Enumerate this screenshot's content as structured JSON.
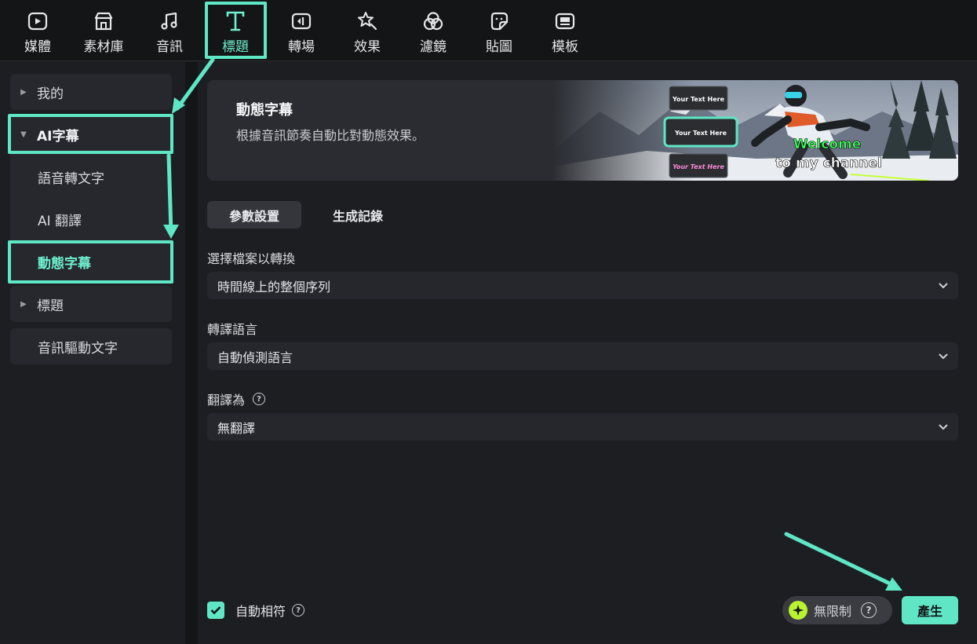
{
  "toolbar": {
    "items": [
      {
        "label": "媒體",
        "icon": "media-icon"
      },
      {
        "label": "素材庫",
        "icon": "library-icon"
      },
      {
        "label": "音訊",
        "icon": "music-icon"
      },
      {
        "label": "標題",
        "icon": "title-icon"
      },
      {
        "label": "轉場",
        "icon": "transition-icon"
      },
      {
        "label": "效果",
        "icon": "effects-icon"
      },
      {
        "label": "濾鏡",
        "icon": "filter-icon"
      },
      {
        "label": "貼圖",
        "icon": "sticker-icon"
      },
      {
        "label": "模板",
        "icon": "template-icon"
      }
    ],
    "active": "標題"
  },
  "sidebar": {
    "items": [
      {
        "label": "我的"
      },
      {
        "label": "AI字幕"
      },
      {
        "label": "語音轉文字"
      },
      {
        "label": "AI 翻譯"
      },
      {
        "label": "動態字幕"
      },
      {
        "label": "標題"
      },
      {
        "label": "音訊驅動文字"
      }
    ],
    "current": "動態字幕"
  },
  "banner": {
    "title": "動態字幕",
    "description": "根據音訊節奏自動比對動態效果。",
    "preview": {
      "card1": "Your Text Here",
      "card2": "Your Text Here",
      "card3": "Your Text Here",
      "caption_line1": "Welcome",
      "caption_line2": "to my channel"
    }
  },
  "tabs": {
    "params": "參數設置",
    "history": "生成記錄",
    "active": "參數設置"
  },
  "form": {
    "source_label": "選擇檔案以轉換",
    "source_value": "時間線上的整個序列",
    "language_label": "轉譯語言",
    "language_value": "自動偵測語言",
    "translate_label": "翻譯為",
    "translate_value": "無翻譯"
  },
  "footer": {
    "auto_match_label": "自動相符",
    "auto_match_checked": true,
    "unlimited_label": "無限制",
    "generate_label": "產生"
  },
  "colors": {
    "accent": "#5fe6c5",
    "background": "#1c1e22",
    "panel": "#26282d",
    "spark": "#b9f22f"
  }
}
